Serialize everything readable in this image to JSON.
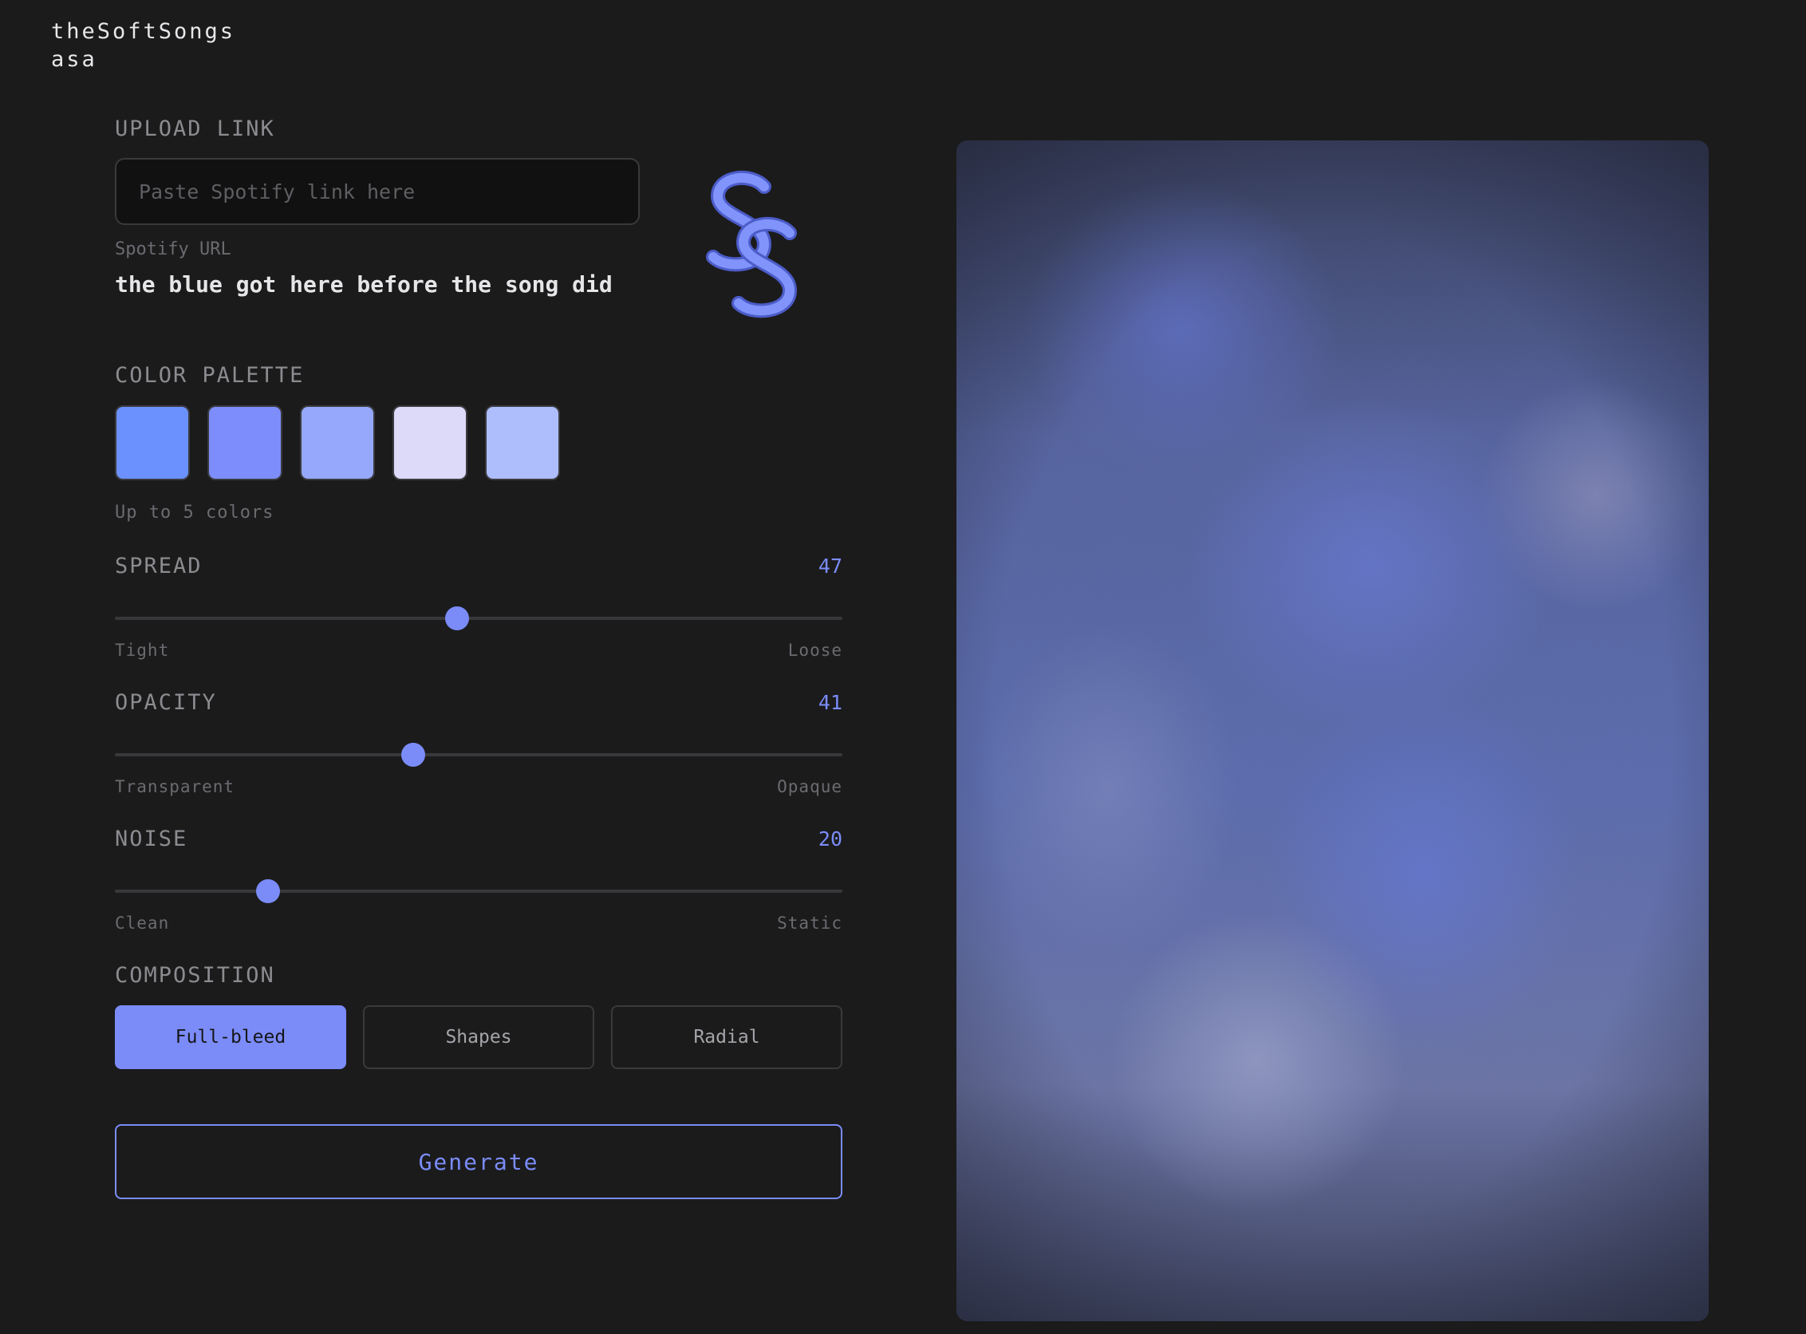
{
  "brand": {
    "line1": "theSoftSongs",
    "line2": "asa"
  },
  "upload": {
    "section_label": "UPLOAD LINK",
    "placeholder": "Paste Spotify link here",
    "value": "",
    "caption": "Spotify URL",
    "track_title": "the blue got here before the song did"
  },
  "logo": {
    "icon": "ss-monogram-icon",
    "color": "#7b8cf8"
  },
  "palette": {
    "section_label": "COLOR PALETTE",
    "colors": [
      "#6b91fe",
      "#7d8dfb",
      "#95a8fc",
      "#dcdaf8",
      "#aebdfc"
    ],
    "caption": "Up to 5 colors"
  },
  "sliders": [
    {
      "label": "SPREAD",
      "value": "47",
      "level": 0.47,
      "min_label": "Tight",
      "max_label": "Loose"
    },
    {
      "label": "OPACITY",
      "value": "41",
      "level": 0.41,
      "min_label": "Transparent",
      "max_label": "Opaque"
    },
    {
      "label": "NOISE",
      "value": "20",
      "level": 0.21,
      "min_label": "Clean",
      "max_label": "Static"
    }
  ],
  "composition": {
    "section_label": "COMPOSITION",
    "options": [
      "Full-bleed",
      "Shapes",
      "Radial"
    ],
    "selected": "Full-bleed"
  },
  "generate_label": "Generate",
  "colors": {
    "accent": "#7b8cf8",
    "background": "#1b1b1c"
  }
}
